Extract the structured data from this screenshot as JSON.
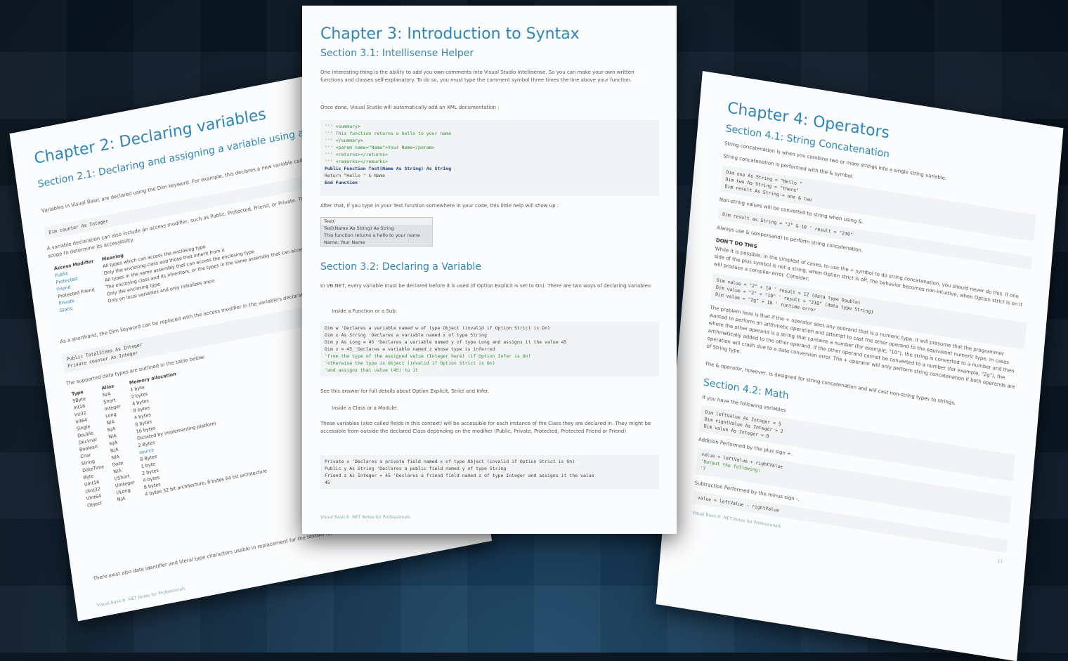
{
  "center": {
    "chapter_title": "Chapter 3: Introduction to Syntax",
    "section1_title": "Section 3.1: Intellisense Helper",
    "section1_para": "One interesting thing is the ability to add you own comments into Visual Studio Intellisense. So you can make your own written functions and classes self-explanatory. To do so, you must type the comment symbol three times the line above your function.",
    "section1_para2": "Once done, Visual Studio will automatically add an XML documentation :",
    "code1": [
      "''' <summary>",
      "''' This function returns a hello to your name",
      "''' </summary>",
      "''' <param name=\"Name\">Your Name</param>",
      "''' <returns></returns>",
      "''' <remarks></remarks>",
      "Public Function Test(Name As String) As String",
      "    Return \"Hello \" & Name",
      "End Function"
    ],
    "after_text": "After that, if you type in your Test function somewhere in your code, this little help will show up :",
    "tooltip": [
      "Test(",
      "Test(Name As String) As String",
      "This function returns a hello to your name",
      "Name: Your Name"
    ],
    "section2_title": "Section 3.2: Declaring a Variable",
    "section2_para": "In VB.NET, every variable must be declared before it is used (If Option Explicit is set to On). There are two ways of declaring variables:",
    "bullet1": "Inside a Function or a Sub:",
    "code2": [
      "Dim w 'Declares a variable named w of type Object (invalid if Option Strict is On)",
      "Dim x As String 'Declares a variable named x of type String",
      "Dim y As Long = 45 'Declares a variable named y of type Long and assigns it the value 45",
      "Dim z = 45 'Declares a variable named z whose type is inferred",
      "           'from the type of the assigned value (Integer here) (if Option Infer is On)",
      "           'otherwise the type is Object (invalid if Option Strict is On)",
      "           'and assigns that value (45) to it"
    ],
    "see_text": "See this answer for full details about Option Explicit, Strict and Infer.",
    "bullet2": "Inside a Class or a Module:",
    "class_para": "These variables (also called fields in this context) will be accessible for each instance of the Class they are declared in. They might be accessible from outside the declared Class depending on the modifier (Public, Private, Protected, Protected Friend or Friend)",
    "code3": [
      "Private x 'Declares a private field named x of type Object (invalid if Option Strict is On)",
      "Public y As String 'Declares a public field named y of type String",
      "Friend z As Integer = 45 'Declares a friend field named z of type Integer and assigns it the value",
      "45"
    ],
    "footer": "Visual Basic® .NET Notes for Professionals"
  },
  "left": {
    "chapter_title": "Chapter 2: Declaring variables",
    "section_title": "Section 2.1: Declaring and assigning a variable using a primitive type",
    "para1": "Variables in Visual Basic are declared using the Dim keyword. For example, this declares a new variable called counter with the data type Integer:",
    "code_dim": "Dim counter As Integer",
    "para2": "A variable declaration can also include an access modifier, such as Public, Protected, Friend, or Private. This works in conjunction with the variable's scope to determine its accessibility.",
    "access_header": [
      "Access Modifier",
      "Meaning"
    ],
    "access_rows": [
      [
        "Public",
        "All types which can access the enclosing type"
      ],
      [
        "Protected",
        "Only the enclosing class and those that inherit from it"
      ],
      [
        "Friend",
        "All types in the same assembly that can access the enclosing type"
      ],
      [
        "Protected Friend",
        "The enclosing class and its inheritors, or the types in the same assembly that can access the enclosing class"
      ],
      [
        "Private",
        "Only the enclosing type"
      ],
      [
        "Static",
        "Only on local variables and only initializes once."
      ]
    ],
    "para3": "As a shorthand, the Dim keyword can be replaced with the access modifier in the variable's declaration:",
    "code_short": [
      "Public TotalItems As Integer",
      "Private counter As Integer"
    ],
    "para4": "The supported data types are outlined in the table below:",
    "types_header": [
      "Type",
      "Alias",
      "Memory allocation"
    ],
    "types_rows": [
      [
        "SByte",
        "N/A",
        "1 byte"
      ],
      [
        "Int16",
        "Short",
        "2 bytes"
      ],
      [
        "Int32",
        "Integer",
        "4 bytes"
      ],
      [
        "Int64",
        "Long",
        "8 bytes"
      ],
      [
        "Single",
        "N/A",
        "4 bytes"
      ],
      [
        "Double",
        "N/A",
        "8 bytes"
      ],
      [
        "Decimal",
        "N/A",
        "16 bytes"
      ],
      [
        "Boolean",
        "N/A",
        "Dictated by implementing platform"
      ],
      [
        "Char",
        "N/A",
        "2 Bytes"
      ],
      [
        "String",
        "N/A",
        "source"
      ],
      [
        "DateTime",
        "Date",
        "8 Bytes"
      ],
      [
        "Byte",
        "N/A",
        "1 byte"
      ],
      [
        "UInt16",
        "UShort",
        "2 bytes"
      ],
      [
        "UInt32",
        "UInteger",
        "4 bytes"
      ],
      [
        "UInt64",
        "ULong",
        "8 bytes"
      ],
      [
        "Object",
        "N/A",
        "4 bytes 32 bit architecture, 8 bytes 64 bit architecture"
      ]
    ],
    "para5": "There exist also data identifier and literal type characters usable in replacement for the textual type and or to force literal type;",
    "footer": "Visual Basic® .NET Notes for Professionals"
  },
  "right": {
    "chapter_title": "Chapter 4: Operators",
    "section1_title": "Section 4.1: String Concatenation",
    "para1": "String concatenation is when you combine two or more strings into a single string variable.",
    "para2": "String concatenation is performed with the & symbol.",
    "code1": [
      "Dim one As String = \"Hello \"",
      "Dim two As String = \"there\"",
      "Dim result As String = one & two"
    ],
    "para3": "Non-string values will be converted to string when using &.",
    "code2": "Dim result as String = \"2\" & 10 ' result = \"210\"",
    "para4": "Always use & (ampersand) to perform string concatenation.",
    "dont_title": "DON'T DO THIS",
    "dont_para": "While it is possible, in the simplest of cases, to use the + symbol to do string concatenation, you should never do this. If one side of the plus symbol is not a string, when Option strict is off, the behavior becomes non-intuitive, when Option strict is on it will produce a compiler error. Consider:",
    "code3": [
      "Dim value = \"2\" + 10    ' result = 12  (data type Double)",
      "Dim value = \"2\" + \"10\"  ' result = \"210\"  (data type String)",
      "Dim value = \"2g\" + 10   ' runtime error"
    ],
    "para5": "The problem here is that if the + operator sees any operand that is a numeric type, it will presume that the programmer wanted to perform an arithmetic operation and attempt to cast the other operand to the equivalent numeric type. In cases where the other operand is a string that contains a number (for example, \"10\"), the string is converted to a number and then arithmetically added to the other operand. If the other operand cannot be converted to a number (for example, \"2g\"), the operation will crash due to a data conversion error. The + operator will only perform string concatenation if both operands are of String type.",
    "para6": "The & operator, however, is designed for string concatenation and will cast non-string types to strings.",
    "section2_title": "Section 4.2: Math",
    "para7": "If you have the following variables",
    "code4": [
      "Dim leftValue As Integer = 5",
      "Dim rightValue As Integer = 2",
      "Dim value As Integer = 0"
    ],
    "addition": "Addition Performed by the plus sign +.",
    "code5": [
      "value = leftValue + rightValue",
      "'Output the following:",
      "'7"
    ],
    "subtraction": "Subtraction Performed by the minus sign -.",
    "code6": "value = leftValue - rightValue",
    "footer": "Visual Basic® .NET Notes for Professionals",
    "page_num": "11"
  }
}
